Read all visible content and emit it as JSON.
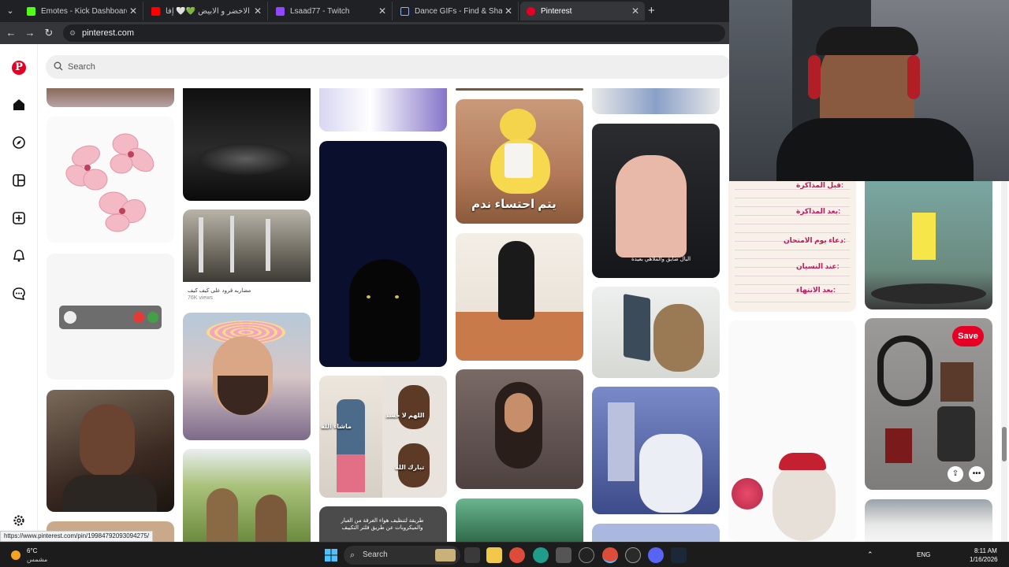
{
  "browser": {
    "tabs": [
      {
        "title": "Emotes - Kick Dashboard",
        "color": "#53fc18"
      },
      {
        "title": "رفرف الاخضر و الابيض 💚🤍 إفا...",
        "color": "#ff0000"
      },
      {
        "title": "Lsaad77 - Twitch",
        "color": "#9146ff"
      },
      {
        "title": "Dance GIFs - Find & Share on GIPHY",
        "color": "#8ab4f8"
      },
      {
        "title": "Pinterest",
        "color": "#e60023"
      }
    ],
    "url": "pinterest.com"
  },
  "pinterest": {
    "search_placeholder": "Search",
    "sidebar": [
      "home-icon",
      "explore-icon",
      "boards-icon",
      "create-icon",
      "notifications-icon",
      "messages-icon",
      "settings-icon"
    ],
    "pin_captions": {
      "duck": "يتم احتساء ندم",
      "car": "البال ضايق والملاهي بعيدة",
      "monkeys": "مضاربه قرود على كيف كيف",
      "monkeys_sub": "76K views",
      "kids_top": "اللهم لا حسد",
      "kids_left": "ماشاء الله",
      "kids_right": "تبارك الله",
      "tips": "طريقة لتنظيف هواء الغرفة من الغبار والميكروبات عن طريق فلتر التكييف"
    },
    "study_card": {
      "headings": [
        "قبل المذاكرة:",
        "بعد المذاكرة:",
        "دعاء يوم الامتحان:",
        "عند النسيان:",
        "بعد الانتهاء:"
      ]
    },
    "save_label": "Save",
    "share_icon": "share-icon",
    "more_icon": "more-icon",
    "status_url": "https://www.pinterest.com/pin/19984792093094275/"
  },
  "taskbar": {
    "weather_temp": "6°C",
    "weather_desc": "مشمس",
    "search_label": "Search",
    "lang": "ENG",
    "time": "8:11 AM",
    "date": "1/16/2026"
  }
}
